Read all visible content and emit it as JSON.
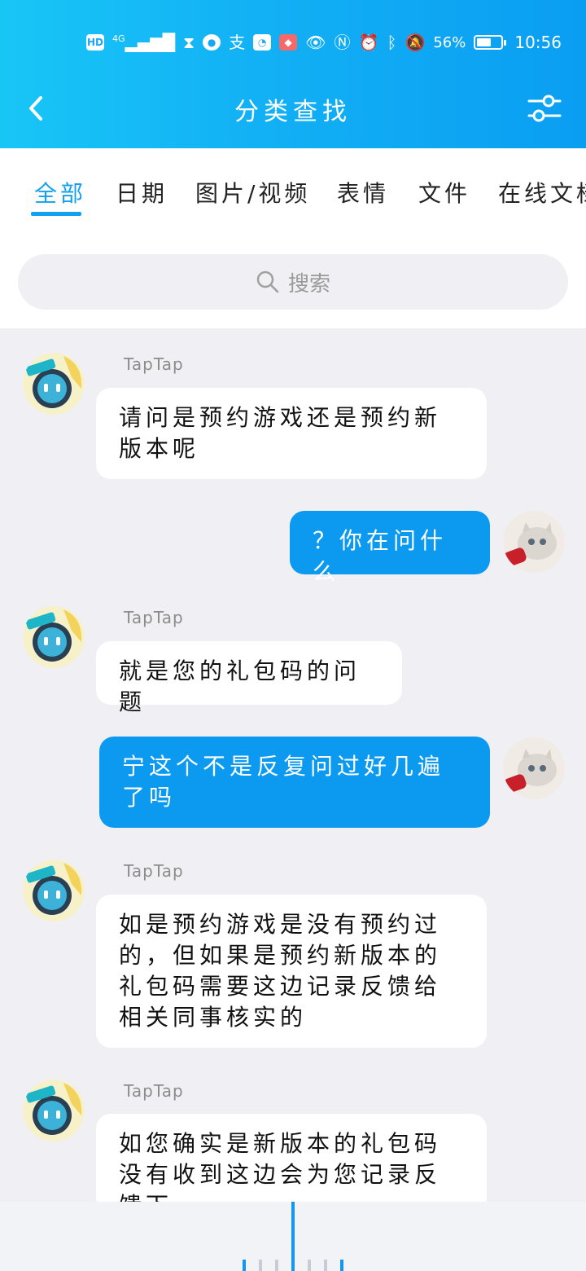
{
  "status_bar": {
    "network": "HD",
    "signal": "4G",
    "battery": "56%",
    "time": "10:56",
    "icons": [
      "hd-icon",
      "signal-icon",
      "hourglass-icon",
      "app-icon",
      "alipay-icon",
      "app-icon",
      "huawei-icon",
      "eye-icon",
      "nfc-icon",
      "alarm-icon",
      "bluetooth-icon",
      "mute-icon",
      "battery-icon"
    ]
  },
  "header": {
    "title": "分类查找",
    "back_icon": "chevron-left-icon",
    "filter_icon": "sliders-icon"
  },
  "tabs": [
    {
      "label": "全部",
      "active": true
    },
    {
      "label": "日期",
      "active": false
    },
    {
      "label": "图片/视频",
      "active": false
    },
    {
      "label": "表情",
      "active": false
    },
    {
      "label": "文件",
      "active": false
    },
    {
      "label": "在线文档",
      "active": false
    }
  ],
  "search": {
    "placeholder": "搜索"
  },
  "messages": [
    {
      "direction": "in",
      "sender": "TapTap",
      "text": "请问是预约游戏还是预约新版本呢"
    },
    {
      "direction": "out",
      "sender": "",
      "text": "？你在问什么"
    },
    {
      "direction": "in",
      "sender": "TapTap",
      "text": "就是您的礼包码的问题"
    },
    {
      "direction": "out",
      "sender": "",
      "text": "宁这个不是反复问过好几遍了吗"
    },
    {
      "direction": "in",
      "sender": "TapTap",
      "text": "如是预约游戏是没有预约过的，但如果是预约新版本的礼包码需要这边记录反馈给相关同事核实的"
    },
    {
      "direction": "in",
      "sender": "TapTap",
      "text": "如您确实是新版本的礼包码没有收到这边会为您记录反馈下"
    }
  ],
  "colors": {
    "accent": "#12a0f0",
    "header_start": "#18c6f6",
    "header_end": "#0a9ef2",
    "bubble_out": "#0c9af1",
    "bubble_in": "#ffffff",
    "background": "#efeff4"
  }
}
